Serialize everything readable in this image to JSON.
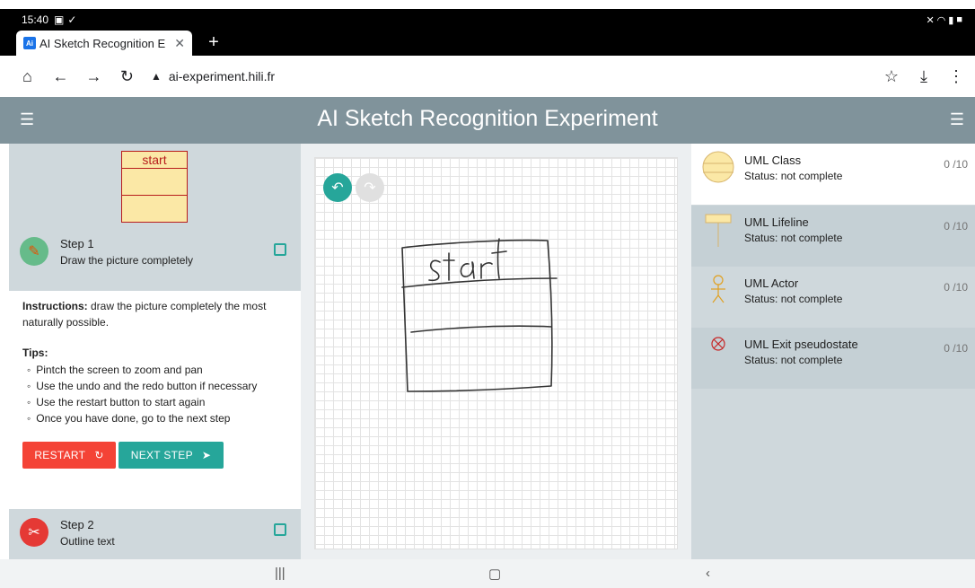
{
  "status_bar": {
    "time": "15:40",
    "left_icons": [
      "image-icon",
      "download-done-icon"
    ],
    "right_icons": [
      "mute-icon",
      "wifi-icon",
      "signal-icon",
      "battery-icon"
    ]
  },
  "browser": {
    "tab_title": "AI Sketch Recognition Exp",
    "favicon_text": "Ai",
    "url": "ai-experiment.hili.fr"
  },
  "app": {
    "title": "AI Sketch Recognition Experiment"
  },
  "left": {
    "preview_label": "start",
    "step1": {
      "title": "Step 1",
      "subtitle": "Draw the picture completely"
    },
    "instructions_label": "Instructions:",
    "instructions_text": " draw the picture completely the most naturally possible.",
    "tips_title": "Tips:",
    "tips": [
      "Pintch the screen to zoom and pan",
      "Use the undo and the redo button if necessary",
      "Use the restart button to start again",
      "Once you have done, go to the next step"
    ],
    "restart_label": "RESTART",
    "next_label": "NEXT STEP",
    "step2": {
      "title": "Step 2",
      "subtitle": "Outline text"
    }
  },
  "shapes": [
    {
      "name": "UML Class",
      "status": "Status: not complete",
      "count": "0 /10",
      "icon": "uml-class-icon"
    },
    {
      "name": "UML Lifeline",
      "status": "Status: not complete",
      "count": "0 /10",
      "icon": "uml-lifeline-icon"
    },
    {
      "name": "UML Actor",
      "status": "Status: not complete",
      "count": "0 /10",
      "icon": "uml-actor-icon"
    },
    {
      "name": "UML Exit pseudostate",
      "status": "Status: not complete",
      "count": "0 /10",
      "icon": "uml-exit-icon"
    }
  ],
  "colors": {
    "header": "#80939b",
    "accent": "#26a69a",
    "danger": "#f44336",
    "panel": "#cfd8dc"
  }
}
